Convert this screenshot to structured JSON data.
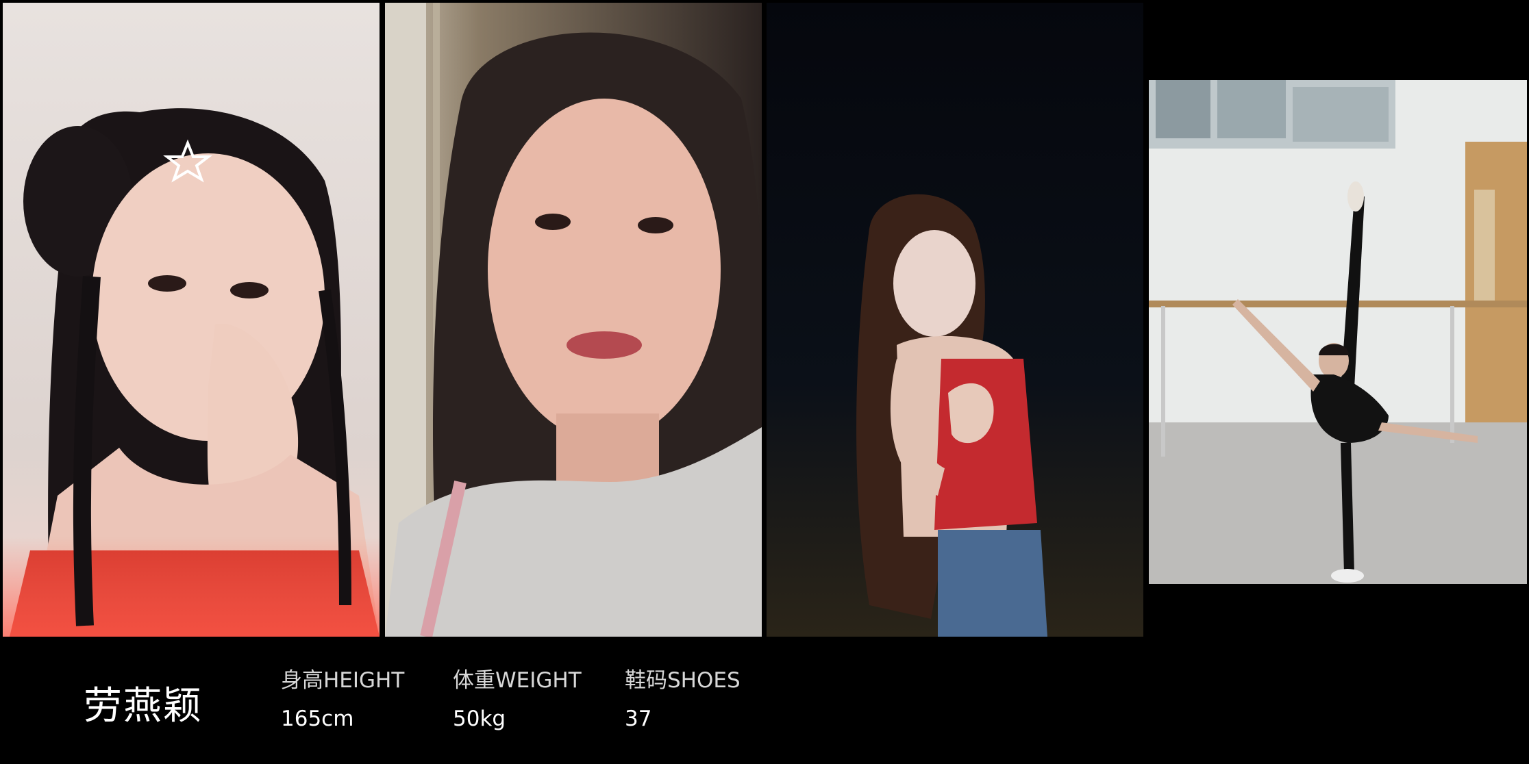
{
  "profile": {
    "name": "劳燕颖",
    "stats": [
      {
        "label": "身高HEIGHT",
        "value": "165cm"
      },
      {
        "label": "体重WEIGHT",
        "value": "50kg"
      },
      {
        "label": "鞋码SHOES",
        "value": "37"
      }
    ]
  },
  "photos": [
    {
      "subject": "portrait with braided hair and star hair clip, hand near face"
    },
    {
      "subject": "close-up selfie, grey sweatshirt"
    },
    {
      "subject": "night photo, red camisole and jeans"
    },
    {
      "subject": "dance studio, leg extension at ballet barre"
    }
  ],
  "colors": {
    "background": "#000000",
    "text": "#ffffff",
    "label": "#d8d8d8"
  }
}
